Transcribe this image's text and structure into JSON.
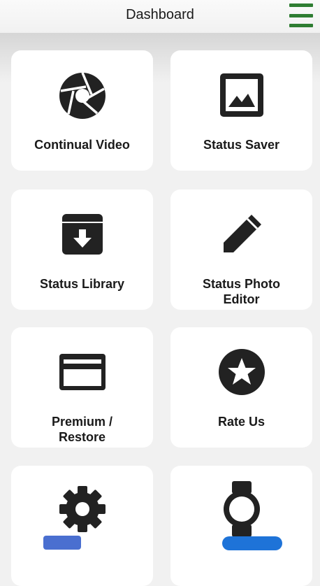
{
  "header": {
    "title": "Dashboard",
    "menu_icon": "hamburger-menu-icon",
    "menu_color": "#2e7d32"
  },
  "cards": [
    {
      "label": "Continual Video",
      "icon": "aperture-icon"
    },
    {
      "label": "Status Saver",
      "icon": "image-icon"
    },
    {
      "label": "Status Library",
      "icon": "archive-icon"
    },
    {
      "label": "Status Photo Editor",
      "icon": "pencil-icon"
    },
    {
      "label": "Premium / Restore",
      "icon": "credit-card-icon"
    },
    {
      "label": "Rate Us",
      "icon": "star-icon"
    },
    {
      "label": "",
      "icon": "gear-icon"
    },
    {
      "label": "",
      "icon": "watch-icon"
    }
  ]
}
